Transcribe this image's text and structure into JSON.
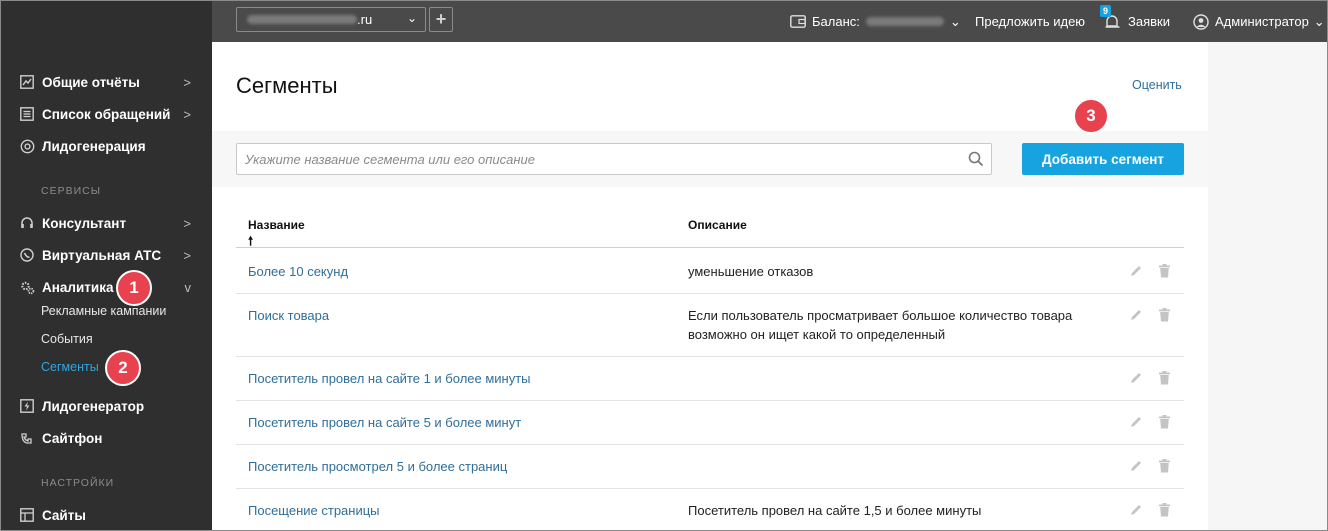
{
  "topbar": {
    "site_domain": ".ru",
    "add_symbol": "+",
    "balance_label": "Баланс:",
    "suggest_idea": "Предложить идею",
    "requests_label": "Заявки",
    "requests_count": "9",
    "user_label": "Администратор"
  },
  "sidebar": {
    "items": [
      {
        "label": "Общие отчёты",
        "arrow": ">"
      },
      {
        "label": "Список обращений",
        "arrow": ">"
      },
      {
        "label": "Лидогенерация",
        "arrow": ""
      }
    ],
    "services_title": "СЕРВИСЫ",
    "services": [
      {
        "label": "Консультант",
        "arrow": ">"
      },
      {
        "label": "Виртуальная АТС",
        "arrow": ">"
      },
      {
        "label": "Аналитика",
        "arrow": "v"
      }
    ],
    "analytics_sub": [
      "Рекламные кампании",
      "События",
      "Сегменты"
    ],
    "after": [
      {
        "label": "Лидогенератор"
      },
      {
        "label": "Сайтфон"
      }
    ],
    "settings_title": "НАСТРОЙКИ",
    "settings": [
      {
        "label": "Сайты"
      }
    ]
  },
  "badges": [
    "1",
    "2",
    "3"
  ],
  "page": {
    "title": "Сегменты",
    "rate_link": "Оценить",
    "search_placeholder": "Укажите название сегмента или его описание",
    "add_button": "Добавить сегмент"
  },
  "table": {
    "col_name": "Название",
    "col_desc": "Описание",
    "sort_arrow": "🠕",
    "rows": [
      {
        "name": "Более 10 секунд",
        "desc": "уменьшение отказов"
      },
      {
        "name": "Поиск товара",
        "desc": "Если пользователь просматривает большое количество товара возможно он ищет какой то определенный"
      },
      {
        "name": "Посетитель провел на сайте 1 и более минуты",
        "desc": ""
      },
      {
        "name": "Посетитель провел на сайте 5 и более минут",
        "desc": ""
      },
      {
        "name": "Посетитель просмотрел 5 и более страниц",
        "desc": ""
      },
      {
        "name": "Посещение страницы",
        "desc": "Посетитель провел на сайте 1,5 и более минуты"
      }
    ]
  },
  "colors": {
    "accent": "#16a3df",
    "link": "#2f6e99",
    "badge": "#e8424f",
    "sidebar_bg": "#2f2f2f",
    "topbar_bg": "#4a4a4a"
  }
}
